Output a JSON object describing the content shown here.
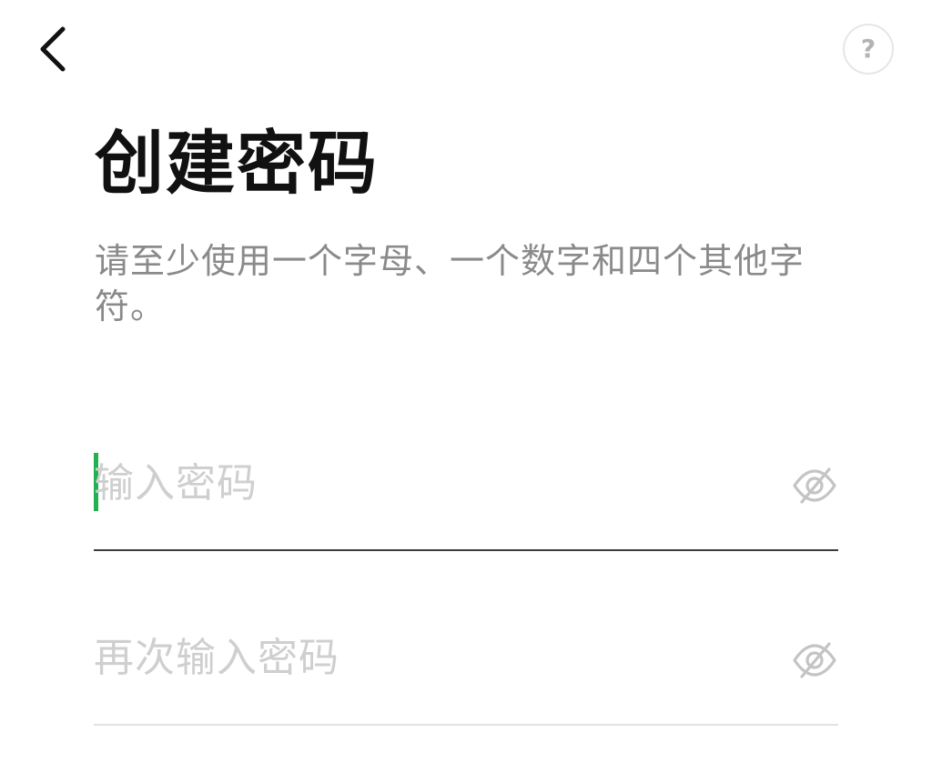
{
  "header": {
    "back_icon": "chevron-left-icon",
    "help_icon": "question-mark-icon",
    "help_label": "?"
  },
  "main": {
    "title": "创建密码",
    "subtitle": "请至少使用一个字母、一个数字和四个其他字符。"
  },
  "form": {
    "password": {
      "placeholder": "输入密码",
      "value": "",
      "visibility_icon": "eye-slash-icon",
      "focused": true
    },
    "confirm_password": {
      "placeholder": "再次输入密码",
      "value": "",
      "visibility_icon": "eye-slash-icon",
      "focused": false
    }
  },
  "colors": {
    "cursor": "#21b14f",
    "title": "#111111",
    "subtitle": "#8a8a8a",
    "placeholder": "#cfcfcf",
    "active_underline": "#3c3c3c",
    "inactive_underline": "#e2e2e2"
  }
}
